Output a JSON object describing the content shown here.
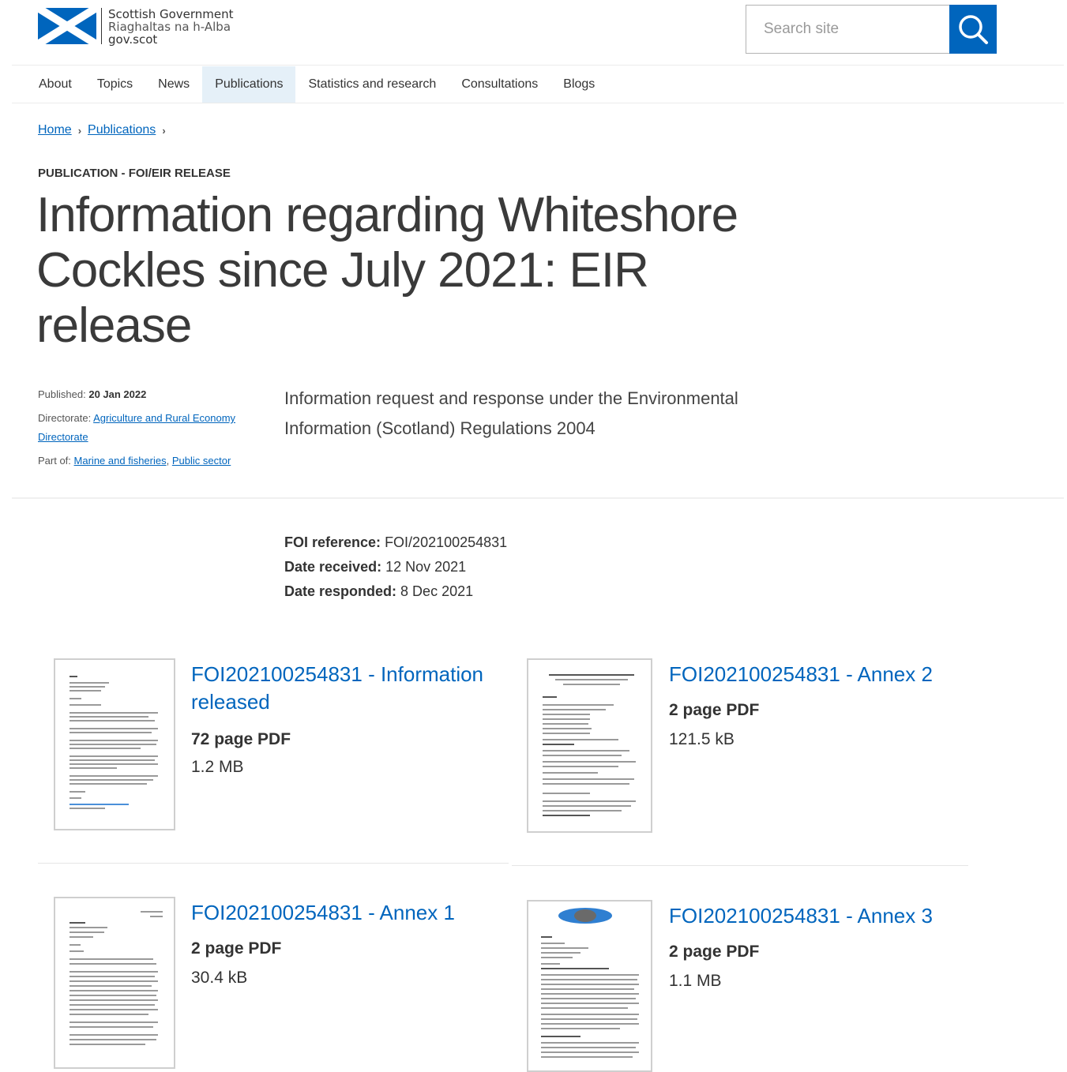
{
  "header": {
    "logo": {
      "line1": "Scottish Government",
      "line2": "Riaghaltas na h-Alba",
      "line3": "gov.scot"
    },
    "search": {
      "placeholder": "Search site",
      "button_icon": "search-icon"
    }
  },
  "nav": {
    "items": [
      {
        "label": "About"
      },
      {
        "label": "Topics"
      },
      {
        "label": "News"
      },
      {
        "label": "Publications",
        "active": true
      },
      {
        "label": "Statistics and research"
      },
      {
        "label": "Consultations"
      },
      {
        "label": "Blogs"
      }
    ]
  },
  "breadcrumb": {
    "items": [
      "Home",
      "Publications"
    ],
    "separator": "›"
  },
  "page": {
    "label": "PUBLICATION - FOI/EIR RELEASE",
    "title": "Information regarding Whiteshore Cockles since July 2021: EIR release",
    "summary": "Information request and response under the Environmental Information (Scotland) Regulations 2004"
  },
  "meta": {
    "published_label": "Published:",
    "published_value": "20 Jan 2022",
    "directorate_label": "Directorate:",
    "directorate_value": "Agriculture and Rural Economy Directorate",
    "part_of_label": "Part of:",
    "part_of_1": "Marine and fisheries",
    "part_of_sep": ",",
    "part_of_2": "Public sector"
  },
  "foi": {
    "reference_label": "FOI reference:",
    "reference_value": "FOI/202100254831",
    "received_label": "Date received:",
    "received_value": "12 Nov 2021",
    "responded_label": "Date responded:",
    "responded_value": "8 Dec 2021"
  },
  "documents": [
    {
      "title": "FOI202100254831 - Information released",
      "pages": "72 page PDF",
      "size": "1.2 MB"
    },
    {
      "title": "FOI202100254831 - Annex 2",
      "pages": "2 page PDF",
      "size": "121.5 kB"
    },
    {
      "title": "FOI202100254831 - Annex 1",
      "pages": "2 page PDF",
      "size": "30.4 kB"
    },
    {
      "title": "FOI202100254831 - Annex 3",
      "pages": "2 page PDF",
      "size": "1.1 MB"
    }
  ],
  "colors": {
    "brand_blue": "#0065bd",
    "nav_active_bg": "#e5f0f8"
  }
}
